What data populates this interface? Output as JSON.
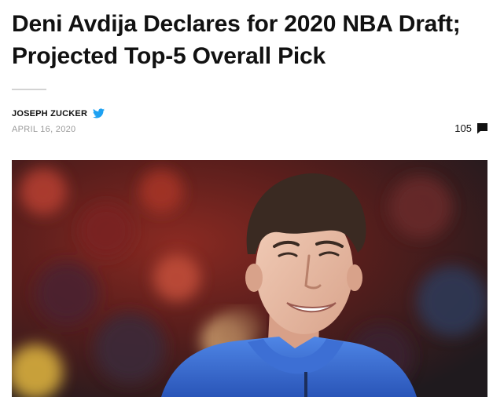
{
  "article": {
    "title": "Deni Avdija Declares for 2020 NBA Draft; Projected Top-5 Overall Pick",
    "author": "JOSEPH ZUCKER",
    "date": "APRIL 16, 2020",
    "comment_count": "105"
  },
  "icons": {
    "author_social": "twitter-icon",
    "comments": "comment-icon"
  },
  "colors": {
    "twitter_blue": "#1da1f2",
    "text": "#111111",
    "muted": "#9a9a9a",
    "divider": "#d3d3d3",
    "jersey_blue": "#2f62c8"
  }
}
